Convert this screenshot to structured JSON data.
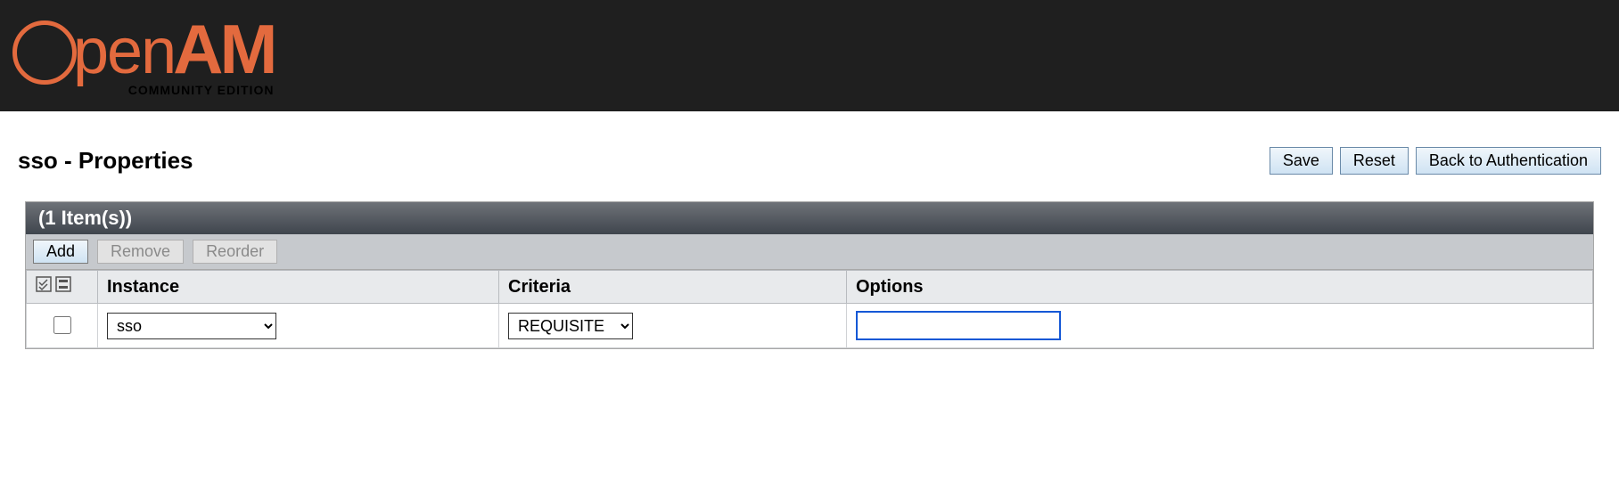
{
  "brand": {
    "open": "pen",
    "am": "AM",
    "subtitle": "COMMUNITY EDITION"
  },
  "page": {
    "title": "sso - Properties"
  },
  "buttons": {
    "save": "Save",
    "reset": "Reset",
    "back": "Back to Authentication"
  },
  "panel": {
    "count_label": "(1 Item(s))"
  },
  "toolbar": {
    "add": "Add",
    "remove": "Remove",
    "reorder": "Reorder"
  },
  "columns": {
    "instance": "Instance",
    "criteria": "Criteria",
    "options": "Options"
  },
  "row": {
    "instance": "sso",
    "criteria": "REQUISITE",
    "options": ""
  }
}
